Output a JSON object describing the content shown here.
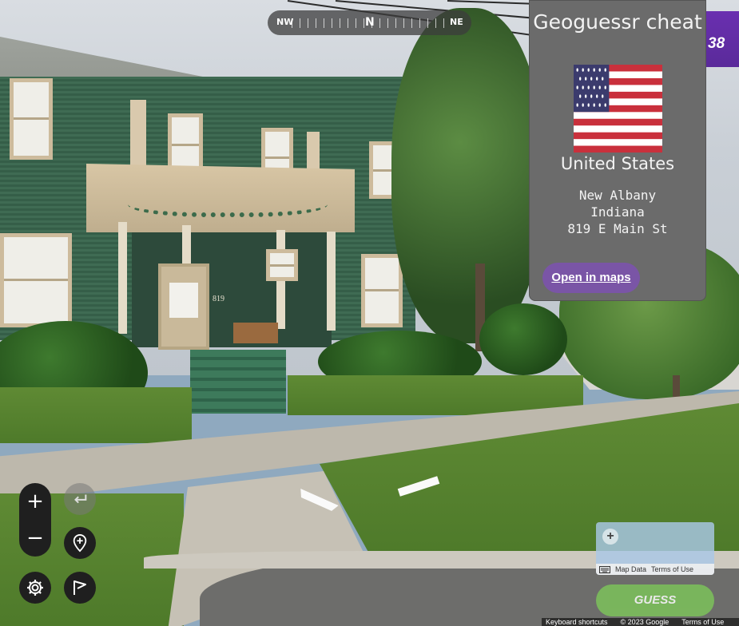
{
  "compass": {
    "left": "NW",
    "center": "N",
    "right": "NE"
  },
  "cheat_panel": {
    "title": "Geoguessr cheat",
    "flag": "us-flag-icon",
    "country": "United States",
    "address": [
      "New Albany",
      "Indiana",
      "819 E Main St"
    ],
    "maps_button": "Open in maps"
  },
  "score_tab": "38",
  "house_number": "819",
  "controls": {
    "zoom_in": "+",
    "zoom_out": "−",
    "undo_icon": "undo-arrow-icon",
    "set_checkpoint_icon": "map-pin-icon",
    "settings_icon": "gear-icon",
    "flag_icon": "flag-icon"
  },
  "minimap": {
    "zoom_in": "+",
    "keyboard_icon": "keyboard-icon",
    "map_data": "Map Data",
    "terms": "Terms of Use",
    "guess_label": "GUESS"
  },
  "google_bar": {
    "shortcuts": "Keyboard shortcuts",
    "copyright": "© 2023 Google",
    "terms": "Terms of Use"
  },
  "colors": {
    "panel_bg": "#6b6b6b",
    "maps_button": "#7a55a6",
    "guess_button": "#7cc25a",
    "score_tab": "#6a2fb0"
  }
}
